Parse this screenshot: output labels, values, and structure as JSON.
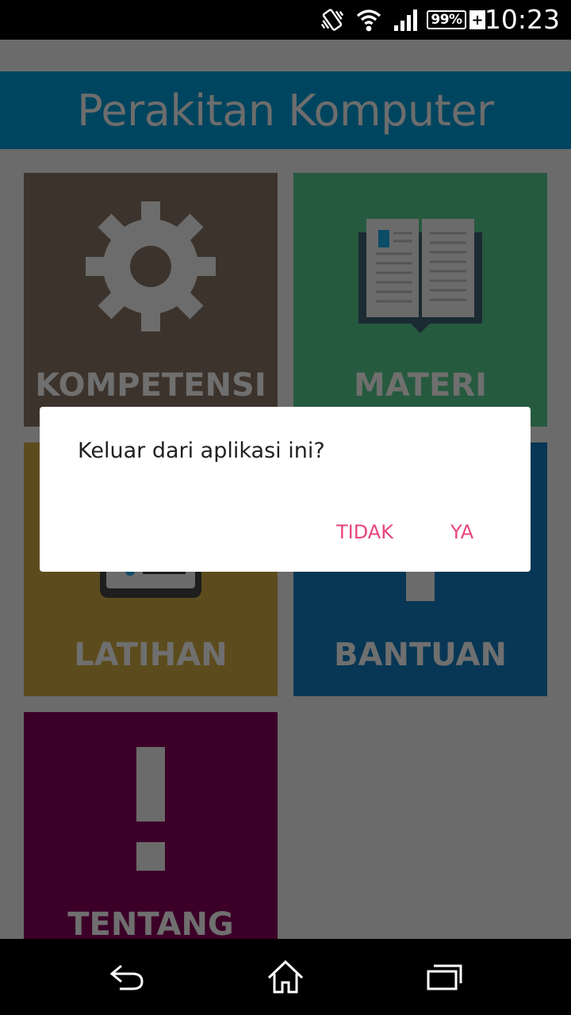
{
  "status_bar": {
    "time": "10:23",
    "battery_percent": "99%",
    "battery_charging": "+",
    "icons": [
      "vibrate-icon",
      "wifi-icon",
      "signal-icon",
      "battery-icon"
    ]
  },
  "app": {
    "title": "Perakitan Komputer",
    "tiles": [
      {
        "label": "KOMPETENSI",
        "icon": "gear-icon",
        "color": "#3c332c"
      },
      {
        "label": "MATERI",
        "icon": "book-icon",
        "color": "#265a3e"
      },
      {
        "label": "LATIHAN",
        "icon": "tablet-icon",
        "color": "#5c4c1d"
      },
      {
        "label": "BANTUAN",
        "icon": "question-icon",
        "color": "#083755"
      },
      {
        "label": "TENTANG",
        "icon": "exclamation-icon",
        "color": "#3c0028"
      }
    ]
  },
  "dialog": {
    "message": "Keluar dari aplikasi ini?",
    "negative_label": "TIDAK",
    "positive_label": "YA",
    "accent_color": "#e8457e"
  },
  "nav_bar": {
    "icons": [
      "back-icon",
      "home-icon",
      "recents-icon"
    ]
  }
}
